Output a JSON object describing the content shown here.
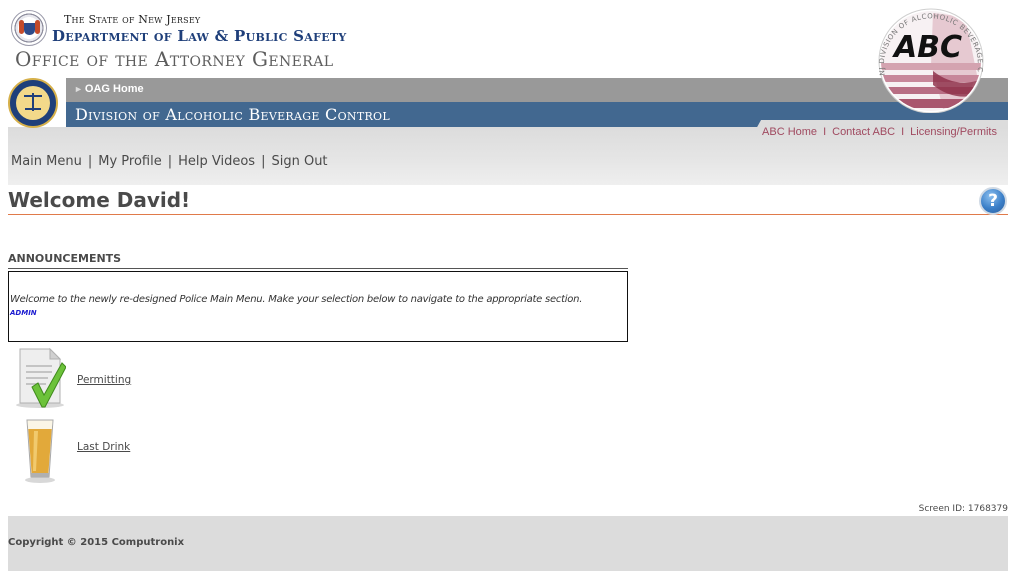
{
  "header": {
    "state_line": "The State of New Jersey",
    "department": "Department of Law & Public Safety",
    "office": "Office of the Attorney General",
    "oag_home_label": "OAG Home",
    "division": "Division of Alcoholic Beverage Control",
    "abc_logo_text": "ABC",
    "abc_logo_ring_text": "NJ DIVISION OF ALCOHOLIC BEVERAGE CONTROL",
    "abc_links": [
      {
        "label": "ABC Home"
      },
      {
        "label": "Contact ABC"
      },
      {
        "label": "Licensing/Permits"
      }
    ],
    "link_separator": "I"
  },
  "nav": {
    "items": [
      {
        "label": "Main Menu"
      },
      {
        "label": "My Profile"
      },
      {
        "label": "Help Videos"
      },
      {
        "label": "Sign Out"
      }
    ],
    "separator": "|"
  },
  "welcome": {
    "title": "Welcome David!",
    "help_icon_glyph": "?"
  },
  "announcements": {
    "title": "ANNOUNCEMENTS",
    "message": "Welcome to the newly re-designed Police Main Menu. Make your selection below to navigate to the appropriate section.",
    "author": "ADMIN"
  },
  "menu": {
    "items": [
      {
        "label": "Permitting",
        "icon": "document-checkmark-icon"
      },
      {
        "label": "Last Drink",
        "icon": "beer-glass-icon"
      }
    ]
  },
  "footer": {
    "screen_id": "Screen ID: 1768379",
    "copyright": "Copyright © 2015 Computronix"
  },
  "colors": {
    "dept_blue": "#1f3f7a",
    "division_band": "#426890",
    "gray_band": "#999999",
    "abc_link": "#a04a60",
    "welcome_rule": "#e07a4a",
    "footer_bg": "#dcdcdc",
    "author_blue": "#1a1ad0"
  }
}
